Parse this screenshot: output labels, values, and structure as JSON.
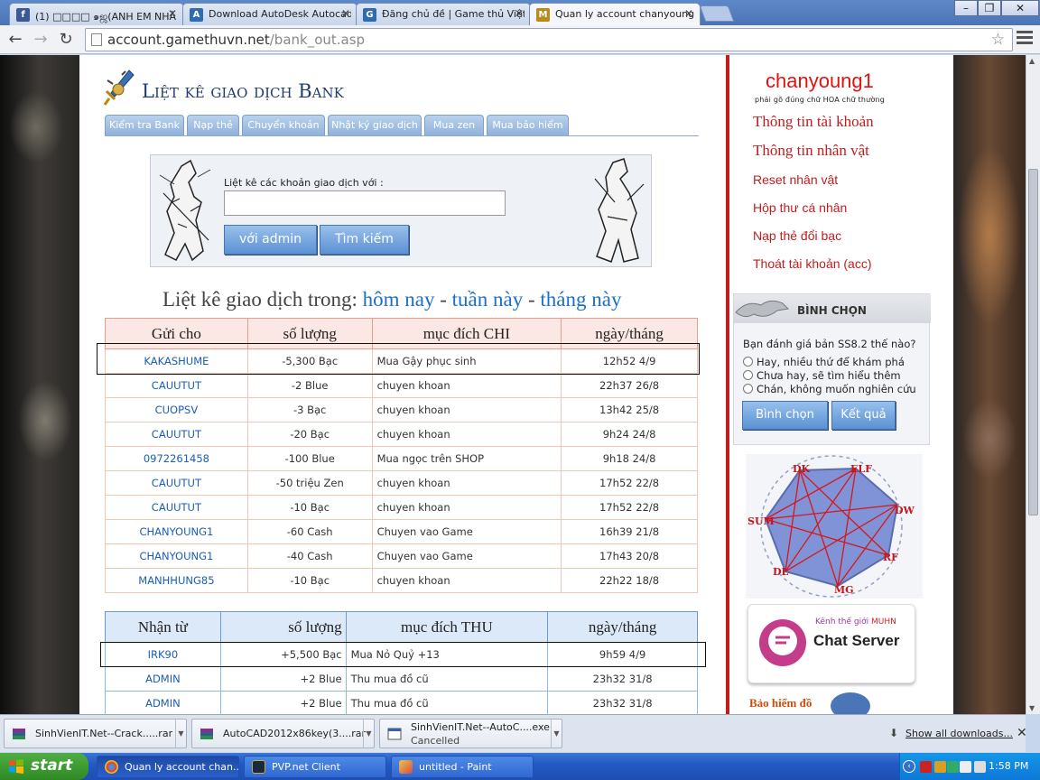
{
  "browser": {
    "tabs": [
      {
        "title": "(1) □□□□ ๑ஜ(ANH EM NHÀ S",
        "icon": "facebook-icon",
        "color": "#3b5998",
        "glyph": "f"
      },
      {
        "title": "Download AutoDesk Autocad",
        "icon": "autodesk-icon",
        "color": "#2d6bb5",
        "glyph": "A"
      },
      {
        "title": "Đăng chủ đề | Game thủ Việt",
        "icon": "gtv-icon",
        "color": "#2d6bb5",
        "glyph": "G"
      },
      {
        "title": "Quan ly account chanyoung1",
        "icon": "game-icon",
        "color": "#b98b1a",
        "glyph": "M"
      }
    ],
    "url_host": "account.gamethuvn.net",
    "url_path": "/bank_out.asp"
  },
  "page": {
    "title": "Liệt kê giao dịch Bank",
    "nav_tabs": [
      "Kiểm tra Bank",
      "Nạp thẻ",
      "Chuyển khoản",
      "Nhật ký giao dịch",
      "Mua zen",
      "Mua bảo hiểm"
    ],
    "search": {
      "label": "Liệt kê các khoản giao dịch với :",
      "input_value": "",
      "btn_admin": "với admin",
      "btn_search": "Tìm kiếm"
    },
    "period": {
      "prefix": "Liệt kê giao dịch trong:",
      "today": "hôm nay",
      "sep1": "-",
      "week": "tuần này",
      "sep2": "-",
      "month": "tháng này"
    },
    "chi_table": {
      "headers": [
        "Gửi cho",
        "số lượng",
        "mục đích CHI",
        "ngày/tháng"
      ],
      "rows": [
        {
          "to": "KAKASHUME",
          "amount": "-5,300  Bạc",
          "purpose": "Mua Gậy phục sinh",
          "date": "12h52 4/9"
        },
        {
          "to": "CAUUTUT",
          "amount": "-2  Blue",
          "purpose": "chuyen khoan",
          "date": "22h37 26/8"
        },
        {
          "to": "CUOPSV",
          "amount": "-3  Bạc",
          "purpose": "chuyen khoan",
          "date": "13h42 25/8"
        },
        {
          "to": "CAUUTUT",
          "amount": "-20  Bạc",
          "purpose": "chuyen khoan",
          "date": "9h24 24/8"
        },
        {
          "to": "0972261458",
          "amount": "-100  Blue",
          "purpose": "Mua ngọc trên SHOP",
          "date": "9h18 24/8"
        },
        {
          "to": "CAUUTUT",
          "amount": "-50  triệu Zen",
          "purpose": "chuyen khoan",
          "date": "17h52 22/8"
        },
        {
          "to": "CAUUTUT",
          "amount": "-10  Bạc",
          "purpose": "chuyen khoan",
          "date": "17h52 22/8"
        },
        {
          "to": "CHANYOUNG1",
          "amount": "-60  Cash",
          "purpose": "Chuyen vao Game",
          "date": "16h39 21/8"
        },
        {
          "to": "CHANYOUNG1",
          "amount": "-40  Cash",
          "purpose": "Chuyen vao Game",
          "date": "17h43 20/8"
        },
        {
          "to": "MANHHUNG85",
          "amount": "-10  Bạc",
          "purpose": "chuyen khoan",
          "date": "22h22 18/8"
        }
      ]
    },
    "thu_table": {
      "headers": [
        "Nhận từ",
        "số lượng",
        "mục đích THU",
        "ngày/tháng"
      ],
      "rows": [
        {
          "from": "IRK90",
          "amount": "+5,500  Bạc",
          "purpose": "Mua Nỏ Quỷ +13",
          "date": "9h59 4/9"
        },
        {
          "from": "ADMIN",
          "amount": "+2  Blue",
          "purpose": "Thu mua đồ cũ",
          "date": "23h32 31/8"
        },
        {
          "from": "ADMIN",
          "amount": "+2  Blue",
          "purpose": "Thu mua đồ cũ",
          "date": "23h32 31/8"
        }
      ]
    }
  },
  "sidebar": {
    "username": "chanyoung1",
    "username_note": "phải gõ đúng chữ HOA chữ thường",
    "links_big": [
      "Thông tin tài khoản",
      "Thông tin nhân vật"
    ],
    "links_small": [
      "Reset nhân vật",
      "Hộp thư cá nhân",
      "Nạp thẻ đổi bạc",
      "Thoát tài khoản (acc)"
    ],
    "vote": {
      "title": "BÌNH CHỌN",
      "question": "Bạn đánh giá bản SS8.2 thế nào?",
      "options": [
        "Hay, nhiều thứ để khám phá",
        "Chưa hay, sẽ tìm hiểu thêm",
        "Chán, không muốn nghiên cứu"
      ],
      "btn_vote": "Bình chọn",
      "btn_result": "Kết quả"
    },
    "class_labels": [
      "DK",
      "ELF",
      "DW",
      "RF",
      "MG",
      "DL",
      "SUM"
    ],
    "chat_banner": {
      "small": "Kênh thế giới",
      "brand": "MUHN",
      "big": "Chat Server"
    },
    "insurance_text": "Bảo hiểm đồ"
  },
  "downloads": {
    "items": [
      {
        "name": "SinhVienIT.Net--Crack.....rar",
        "status": ""
      },
      {
        "name": "AutoCAD2012x86key(3....rar",
        "status": ""
      },
      {
        "name": "SinhVienIT.Net--AutoC....exe",
        "status": "Cancelled"
      }
    ],
    "show_all": "Show all downloads..."
  },
  "taskbar": {
    "start": "start",
    "tasks": [
      "Quan ly account chan...",
      "PVP.net Client",
      "untitled - Paint"
    ],
    "clock": "1:58 PM"
  }
}
